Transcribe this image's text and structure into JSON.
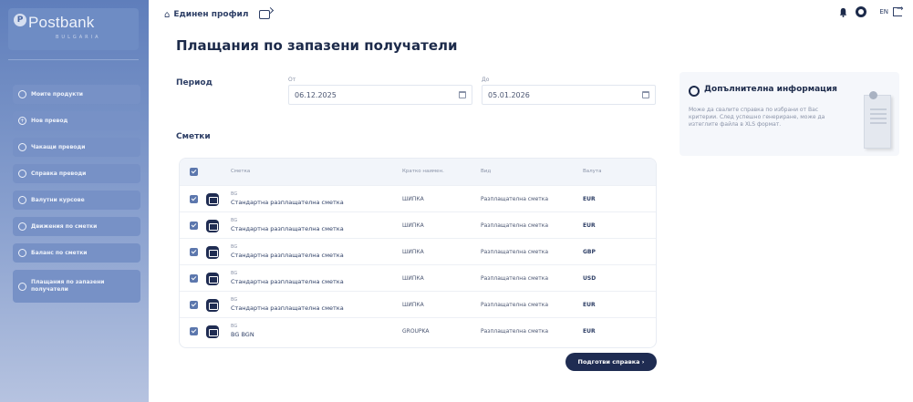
{
  "brand": {
    "name": "Postbank",
    "subtitle": "BULGARIA"
  },
  "sidebar": {
    "items": [
      {
        "label": "Моите продукти",
        "icon": "cloud-icon"
      },
      {
        "label": "Нов превод",
        "icon": "plus-circle-icon"
      },
      {
        "label": "Чакащи преводи",
        "icon": "clock-icon"
      },
      {
        "label": "Справка преводи",
        "icon": "document-icon"
      },
      {
        "label": "Валутни курсове",
        "icon": "exchange-icon"
      },
      {
        "label": "Движения по сметки",
        "icon": "list-icon"
      },
      {
        "label": "Баланс по сметки",
        "icon": "balance-icon"
      },
      {
        "label": "Плащания по запазени получатели",
        "icon": "users-icon"
      }
    ]
  },
  "topbar": {
    "profile_name": "Единен профил",
    "lang": "EN"
  },
  "page": {
    "title": "Плащания по запазени получатели",
    "period_label": "Период",
    "from_label": "От",
    "to_label": "До",
    "from_date": "06.12.2025",
    "to_date": "05.01.2026",
    "accounts_label": "Сметки"
  },
  "table": {
    "headers": {
      "account": "Сметка",
      "name": "Кратко наимен.",
      "type": "Вид",
      "currency": "Валута"
    },
    "rows": [
      {
        "num": "BG",
        "name": "Стандартна разплащателна сметка",
        "short": "ШИПКА",
        "type": "Разплащателна сметка",
        "currency": "EUR"
      },
      {
        "num": "BG",
        "name": "Стандартна разплащателна сметка",
        "short": "ШИПКА",
        "type": "Разплащателна сметка",
        "currency": "EUR"
      },
      {
        "num": "BG",
        "name": "Стандартна разплащателна сметка",
        "short": "ШИПКА",
        "type": "Разплащателна сметка",
        "currency": "GBP"
      },
      {
        "num": "BG",
        "name": "Стандартна разплащателна сметка",
        "short": "ШИПКА",
        "type": "Разплащателна сметка",
        "currency": "USD"
      },
      {
        "num": "BG",
        "name": "Стандартна разплащателна сметка",
        "short": "ШИПКА",
        "type": "Разплащателна сметка",
        "currency": "EUR"
      },
      {
        "num": "BG",
        "name": "BG                 BGN",
        "short": "GROUPKA",
        "type": "Разплащателна сметка",
        "currency": "EUR"
      }
    ]
  },
  "actions": {
    "prepare_label": "Подготви справка  ›"
  },
  "info": {
    "title": "Допълнителна информация",
    "text": "Може да свалите справка по избрани от Вас критерии. След успешно генериране, може да изтеглите файла в XLS формат."
  }
}
